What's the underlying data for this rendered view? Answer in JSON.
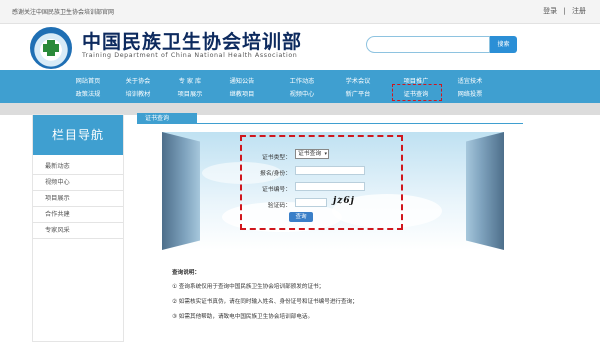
{
  "topbar": {
    "welcome": "感谢关注中国民族卫生协会培训部官网",
    "login": "登录",
    "divider": "|",
    "register": "注册"
  },
  "header": {
    "org_name_cn": "中国民族卫生协会培训部",
    "org_name_en": "Training Department of China National Health Association",
    "search_placeholder": "",
    "search_button": "搜索"
  },
  "nav": {
    "row1": [
      "网站首页",
      "关于协会",
      "专 家 库",
      "通知公告",
      "工作动态",
      "学术会议",
      "项目推广",
      "适宜技术"
    ],
    "row2": [
      "政策法规",
      "培训教材",
      "项目展示",
      "继教项目",
      "视频中心",
      "新广平台",
      "证书查询",
      "网络投票"
    ]
  },
  "sidebar": {
    "title": "栏目导航",
    "items": [
      "最新动态",
      "视频中心",
      "项目展示",
      "合作共建",
      "专家风采"
    ]
  },
  "main": {
    "section_title": "证书查询",
    "form": {
      "cert_type_label": "证书类型：",
      "cert_type_value": "证书查询",
      "id_label": "报名/身份：",
      "cert_no_label": "证书编号：",
      "captcha_label": "验证码：",
      "captcha_text": "jz6j",
      "submit": "查询"
    },
    "notes": {
      "title": "查询说明：",
      "lines": [
        "① 查询系统仅用于查询中国民族卫生协会培训部颁发的证书；",
        "② 如需核实证书真伪，请在同时输入姓名、身份证号和证书编号进行查询；",
        "③ 如需其他帮助，请致电中国民族卫生协会培训部电话。"
      ]
    }
  },
  "colors": {
    "nav_blue": "#3f9fd0",
    "highlight_red": "#d0161d",
    "org_navy": "#0d2a5e"
  }
}
